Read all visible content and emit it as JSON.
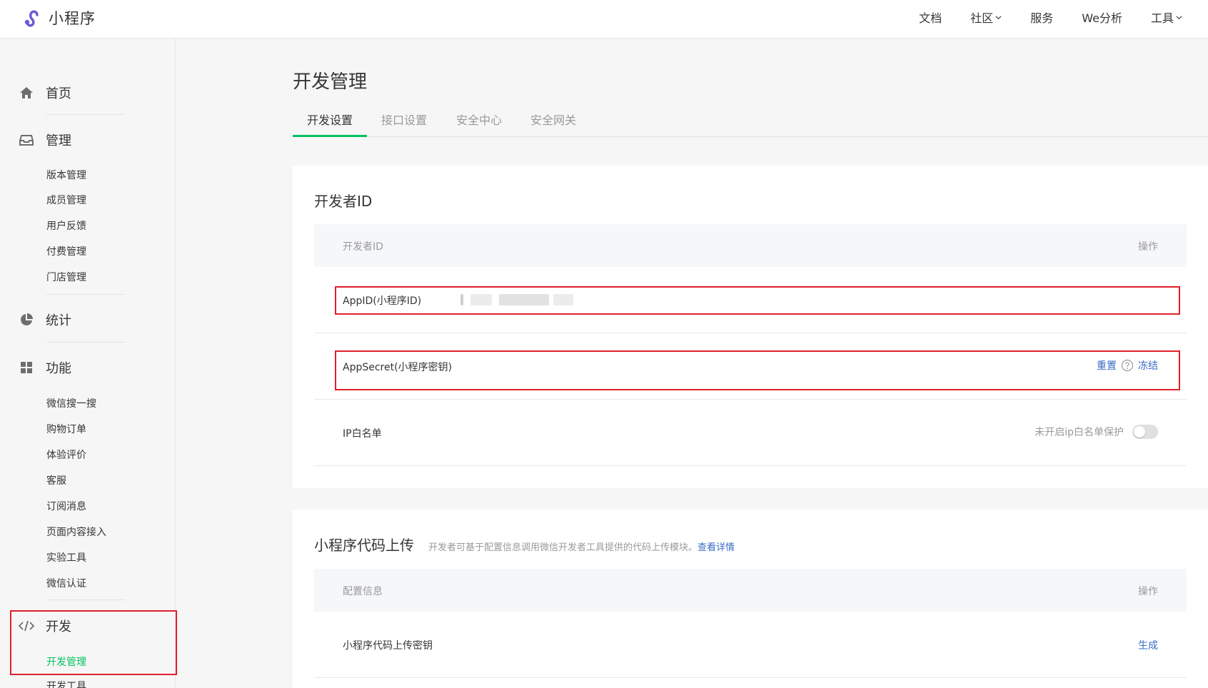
{
  "app": {
    "logo_text": "小程序"
  },
  "topnav": [
    {
      "label": "文档",
      "dropdown": false
    },
    {
      "label": "社区",
      "dropdown": true
    },
    {
      "label": "服务",
      "dropdown": false
    },
    {
      "label": "We分析",
      "dropdown": false
    },
    {
      "label": "工具",
      "dropdown": true
    }
  ],
  "sidebar": {
    "home": "首页",
    "manage": {
      "label": "管理",
      "items": [
        "版本管理",
        "成员管理",
        "用户反馈",
        "付费管理",
        "门店管理"
      ]
    },
    "stats": "统计",
    "features": {
      "label": "功能",
      "items": [
        "微信搜一搜",
        "购物订单",
        "体验评价",
        "客服",
        "订阅消息",
        "页面内容接入",
        "实验工具",
        "微信认证"
      ]
    },
    "dev": {
      "label": "开发",
      "items": [
        "开发管理",
        "开发工具"
      ],
      "active": "开发管理"
    }
  },
  "main": {
    "title": "开发管理",
    "tabs": [
      "开发设置",
      "接口设置",
      "安全中心",
      "安全网关"
    ],
    "active_tab": "开发设置",
    "dev_id_card": {
      "title": "开发者ID",
      "col_left": "开发者ID",
      "col_right": "操作",
      "appid_label": "AppID(小程序ID)",
      "secret_label": "AppSecret(小程序密钥)",
      "reset": "重置",
      "freeze": "冻结",
      "ip_label": "IP白名单",
      "ip_status": "未开启ip白名单保护",
      "ip_protection_on": false
    },
    "upload_card": {
      "title": "小程序代码上传",
      "desc": "开发者可基于配置信息调用微信开发者工具提供的代码上传模块。",
      "desc_link": "查看详情",
      "col_left": "配置信息",
      "col_right": "操作",
      "key_label": "小程序代码上传密钥",
      "generate": "生成"
    }
  },
  "colors": {
    "accent": "#07c160",
    "link": "#3a6cc6",
    "highlight": "#e0202a"
  }
}
